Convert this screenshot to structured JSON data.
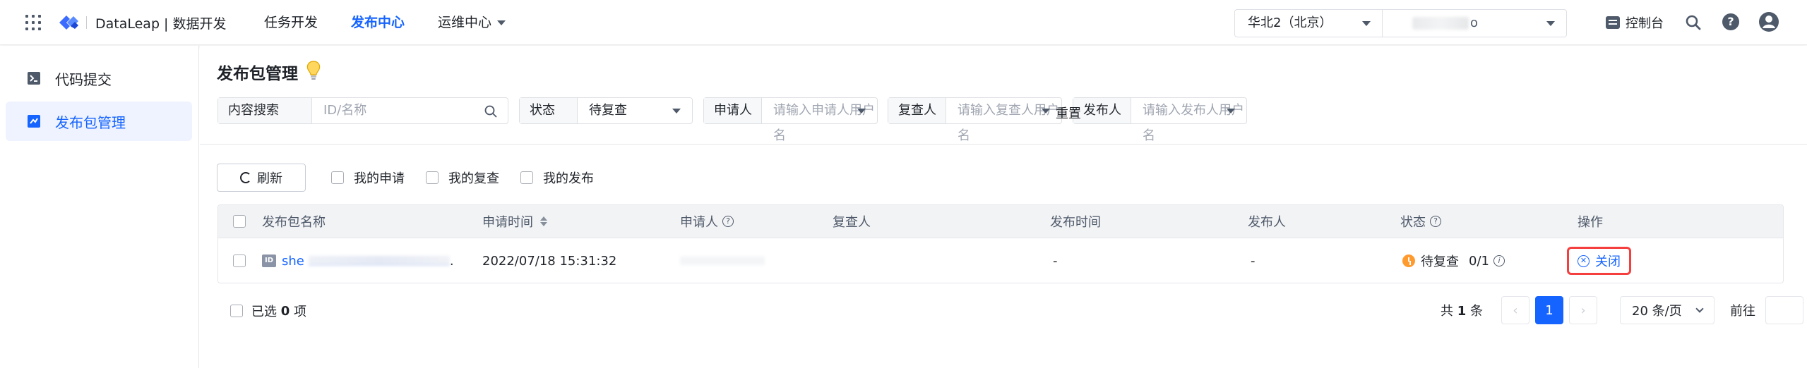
{
  "topbar": {
    "brand": "DataLeap | 数据开发",
    "nav": [
      {
        "label": "任务开发",
        "active": false
      },
      {
        "label": "发布中心",
        "active": true
      },
      {
        "label": "运维中心",
        "active": false
      }
    ],
    "region": "华北2（北京）",
    "project_suffix": "o",
    "console": "控制台"
  },
  "sidebar": {
    "items": [
      {
        "label": "代码提交",
        "active": false
      },
      {
        "label": "发布包管理",
        "active": true
      }
    ]
  },
  "page": {
    "title": "发布包管理"
  },
  "filters": {
    "search": {
      "label": "内容搜索",
      "placeholder": "ID/名称"
    },
    "status": {
      "label": "状态",
      "value": "待复查"
    },
    "applicant": {
      "label": "申请人",
      "placeholder": "请输入申请人用户名"
    },
    "reviewer": {
      "label": "复查人",
      "placeholder": "请输入复查人用户名"
    },
    "publisher": {
      "label": "发布人",
      "placeholder": "请输入发布人用户名"
    },
    "reset": "重置"
  },
  "toolbar": {
    "refresh": "刷新",
    "my_apply": "我的申请",
    "my_review": "我的复查",
    "my_publish": "我的发布"
  },
  "table": {
    "headers": {
      "name": "发布包名称",
      "apply_time": "申请时间",
      "applicant": "申请人",
      "reviewer": "复查人",
      "publish_time": "发布时间",
      "publisher": "发布人",
      "status": "状态",
      "action": "操作"
    },
    "rows": [
      {
        "id_badge": "ID",
        "name_prefix": "she",
        "name_suffix": ".",
        "apply_time": "2022/07/18  15:31:32",
        "publish_time": "-",
        "publisher": "-",
        "status": "待复查",
        "review_count": "0/1",
        "action": "关闭"
      }
    ]
  },
  "footer": {
    "selected_prefix": "已选",
    "selected_count": "0",
    "selected_suffix": "项",
    "total_prefix": "共",
    "total_count": "1",
    "total_suffix": "条",
    "current_page": "1",
    "page_size": "20 条/页",
    "goto": "前往"
  },
  "colors": {
    "primary": "#1664ff",
    "highlight_border": "#f53f3f",
    "status_pending": "#ff9a2e"
  }
}
